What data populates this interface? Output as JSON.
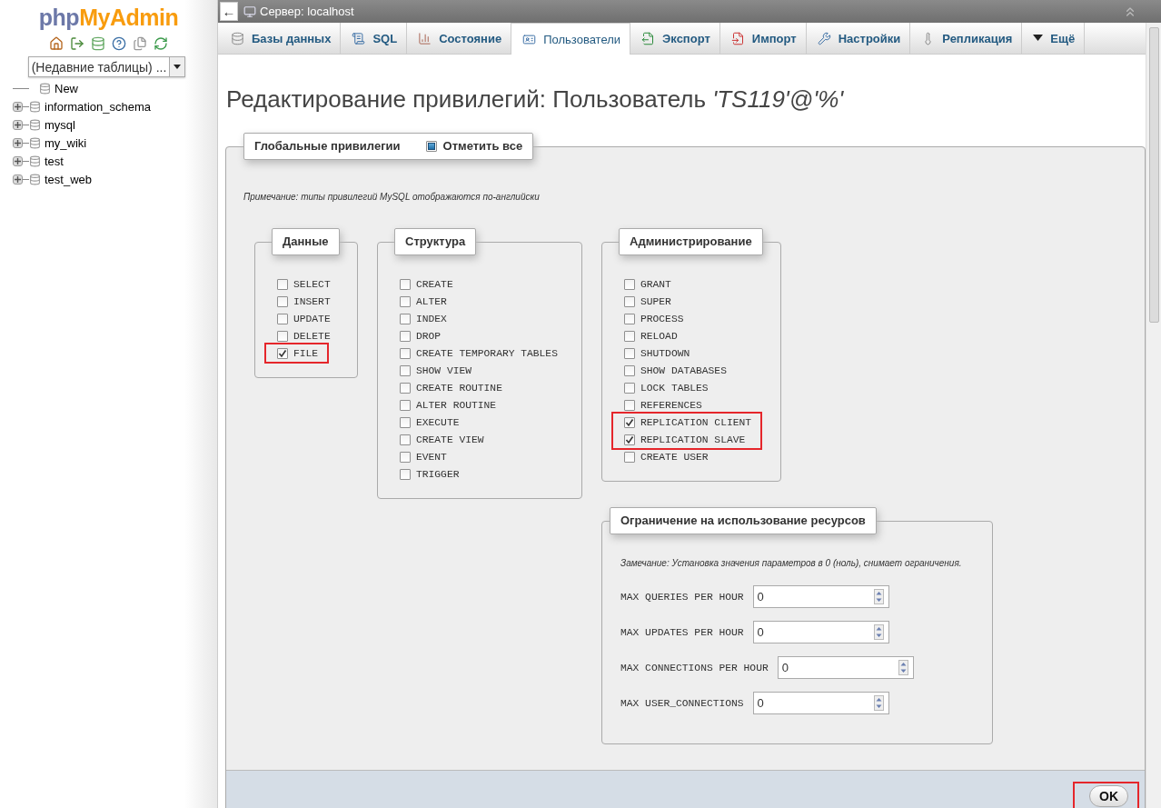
{
  "sidebar": {
    "logo": {
      "php": "php",
      "brand": "MyAdmin"
    },
    "recent_tables": "(Недавние таблицы) ...",
    "tree": [
      {
        "label": "New",
        "kind": "new"
      },
      {
        "label": "information_schema",
        "kind": "database",
        "expanded": false
      },
      {
        "label": "mysql",
        "kind": "database",
        "expanded": false
      },
      {
        "label": "my_wiki",
        "kind": "database",
        "expanded": false
      },
      {
        "label": "test",
        "kind": "database",
        "expanded": false
      },
      {
        "label": "test_web",
        "kind": "database",
        "expanded": false
      }
    ]
  },
  "topbar": {
    "back": "←",
    "title": "Сервер: localhost"
  },
  "tabs": [
    {
      "label": "Базы данных",
      "kind": "databases",
      "selected": false
    },
    {
      "label": "SQL",
      "kind": "sql",
      "selected": false
    },
    {
      "label": "Состояние",
      "kind": "status",
      "selected": false
    },
    {
      "label": "Пользователи",
      "kind": "users",
      "selected": true
    },
    {
      "label": "Экспорт",
      "kind": "export",
      "selected": false
    },
    {
      "label": "Импорт",
      "kind": "import",
      "selected": false
    },
    {
      "label": "Настройки",
      "kind": "settings",
      "selected": false
    },
    {
      "label": "Репликация",
      "kind": "replication",
      "selected": false
    },
    {
      "label": "Ещё",
      "kind": "more",
      "selected": false
    }
  ],
  "title": "Редактирование привилегий: Пользователь *'TS119'@'%'*",
  "global_privileges": {
    "legend": "Глобальные привилегии",
    "check_all": {
      "label": "Отметить все",
      "checked": false,
      "indeterminate": true
    },
    "note": "Примечание: типы привилегий MySQL отображаются по-английски",
    "groups": [
      {
        "legend": "Данные",
        "items": [
          {
            "label": "SELECT",
            "checked": false,
            "highlighted": false
          },
          {
            "label": "INSERT",
            "checked": false,
            "highlighted": false
          },
          {
            "label": "UPDATE",
            "checked": false,
            "highlighted": false
          },
          {
            "label": "DELETE",
            "checked": false,
            "highlighted": false
          },
          {
            "label": "FILE",
            "checked": true,
            "highlighted": true
          }
        ]
      },
      {
        "legend": "Структура",
        "items": [
          {
            "label": "CREATE",
            "checked": false,
            "highlighted": false
          },
          {
            "label": "ALTER",
            "checked": false,
            "highlighted": false
          },
          {
            "label": "INDEX",
            "checked": false,
            "highlighted": false
          },
          {
            "label": "DROP",
            "checked": false,
            "highlighted": false
          },
          {
            "label": "CREATE TEMPORARY TABLES",
            "checked": false,
            "highlighted": false
          },
          {
            "label": "SHOW VIEW",
            "checked": false,
            "highlighted": false
          },
          {
            "label": "CREATE ROUTINE",
            "checked": false,
            "highlighted": false
          },
          {
            "label": "ALTER ROUTINE",
            "checked": false,
            "highlighted": false
          },
          {
            "label": "EXECUTE",
            "checked": false,
            "highlighted": false
          },
          {
            "label": "CREATE VIEW",
            "checked": false,
            "highlighted": false
          },
          {
            "label": "EVENT",
            "checked": false,
            "highlighted": false
          },
          {
            "label": "TRIGGER",
            "checked": false,
            "highlighted": false
          }
        ]
      },
      {
        "legend": "Администрирование",
        "items": [
          {
            "label": "GRANT",
            "checked": false,
            "highlighted": false
          },
          {
            "label": "SUPER",
            "checked": false,
            "highlighted": false
          },
          {
            "label": "PROCESS",
            "checked": false,
            "highlighted": false
          },
          {
            "label": "RELOAD",
            "checked": false,
            "highlighted": false
          },
          {
            "label": "SHUTDOWN",
            "checked": false,
            "highlighted": false
          },
          {
            "label": "SHOW DATABASES",
            "checked": false,
            "highlighted": false
          },
          {
            "label": "LOCK TABLES",
            "checked": false,
            "highlighted": false
          },
          {
            "label": "REFERENCES",
            "checked": false,
            "highlighted": false
          },
          {
            "label": "REPLICATION CLIENT",
            "checked": true,
            "highlighted": true
          },
          {
            "label": "REPLICATION SLAVE",
            "checked": true,
            "highlighted": true
          },
          {
            "label": "CREATE USER",
            "checked": false,
            "highlighted": false
          }
        ]
      }
    ],
    "resource_limits": {
      "legend": "Ограничение на использование ресурсов",
      "note": "Замечание: Установка значения параметров в 0 (ноль), снимает ограничения.",
      "fields": [
        {
          "label": "MAX QUERIES PER HOUR",
          "value": "0"
        },
        {
          "label": "MAX UPDATES PER HOUR",
          "value": "0"
        },
        {
          "label": "MAX CONNECTIONS PER HOUR",
          "value": "0"
        },
        {
          "label": "MAX USER_CONNECTIONS",
          "value": "0"
        }
      ]
    },
    "ok_button": {
      "label": "OK",
      "highlighted": true
    }
  }
}
